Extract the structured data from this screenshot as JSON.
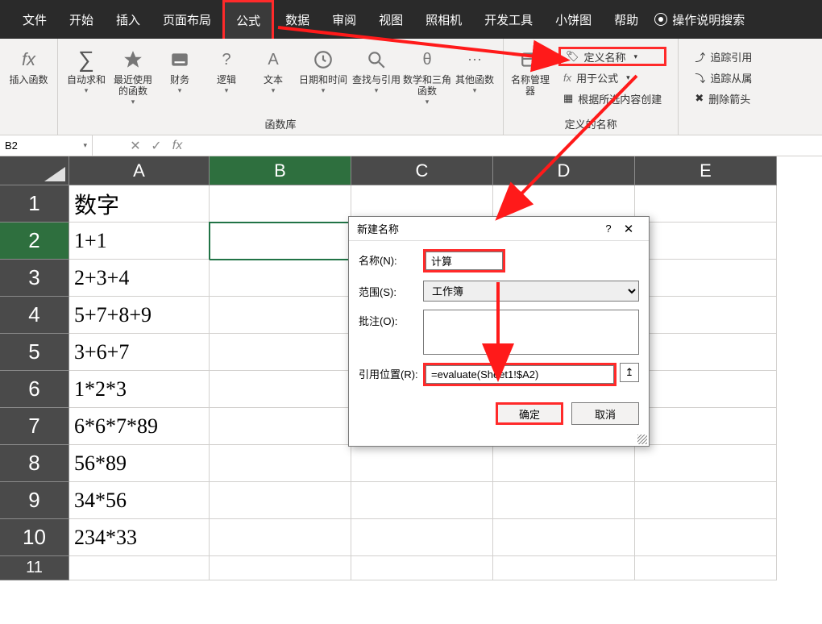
{
  "tabs": {
    "file": "文件",
    "home": "开始",
    "insert": "插入",
    "pagelayout": "页面布局",
    "formulas": "公式",
    "data": "数据",
    "review": "审阅",
    "view": "视图",
    "camera": "照相机",
    "devtools": "开发工具",
    "sparkline": "小饼图",
    "help": "帮助",
    "tell": "操作说明搜索"
  },
  "ribbon": {
    "insertfn_label": "插入函数",
    "insertfn_fx": "fx",
    "autosum": "自动求和",
    "recent": "最近使用的函数",
    "financial": "财务",
    "logical": "逻辑",
    "text": "文本",
    "datetime": "日期和时间",
    "lookup": "查找与引用",
    "mathtrig": "数学和三角函数",
    "morefn": "其他函数",
    "grp_fnlib": "函数库",
    "namemgr": "名称管理器",
    "definename": "定义名称",
    "useinformula": "用于公式",
    "createfromsel": "根据所选内容创建",
    "grp_names": "定义的名称",
    "traceprec": "追踪引用",
    "tracedep": "追踪从属",
    "removearrows": "删除箭头"
  },
  "namebox": "B2",
  "columns": [
    "A",
    "B",
    "C",
    "D",
    "E"
  ],
  "rows": [
    {
      "n": "1",
      "a": "数字"
    },
    {
      "n": "2",
      "a": "1+1"
    },
    {
      "n": "3",
      "a": "2+3+4"
    },
    {
      "n": "4",
      "a": "5+7+8+9"
    },
    {
      "n": "5",
      "a": "3+6+7"
    },
    {
      "n": "6",
      "a": "1*2*3"
    },
    {
      "n": "7",
      "a": "6*6*7*89"
    },
    {
      "n": "8",
      "a": "56*89"
    },
    {
      "n": "9",
      "a": "34*56"
    },
    {
      "n": "10",
      "a": "234*33"
    },
    {
      "n": "11",
      "a": ""
    }
  ],
  "dialog": {
    "title": "新建名称",
    "help": "?",
    "close": "✕",
    "lbl_name": "名称(N):",
    "val_name": "计算",
    "lbl_scope": "范围(S):",
    "val_scope": "工作簿",
    "lbl_comment": "批注(O):",
    "val_comment": "",
    "lbl_ref": "引用位置(R):",
    "val_ref": "=evaluate(Sheet1!$A2)",
    "ok": "确定",
    "cancel": "取消"
  }
}
